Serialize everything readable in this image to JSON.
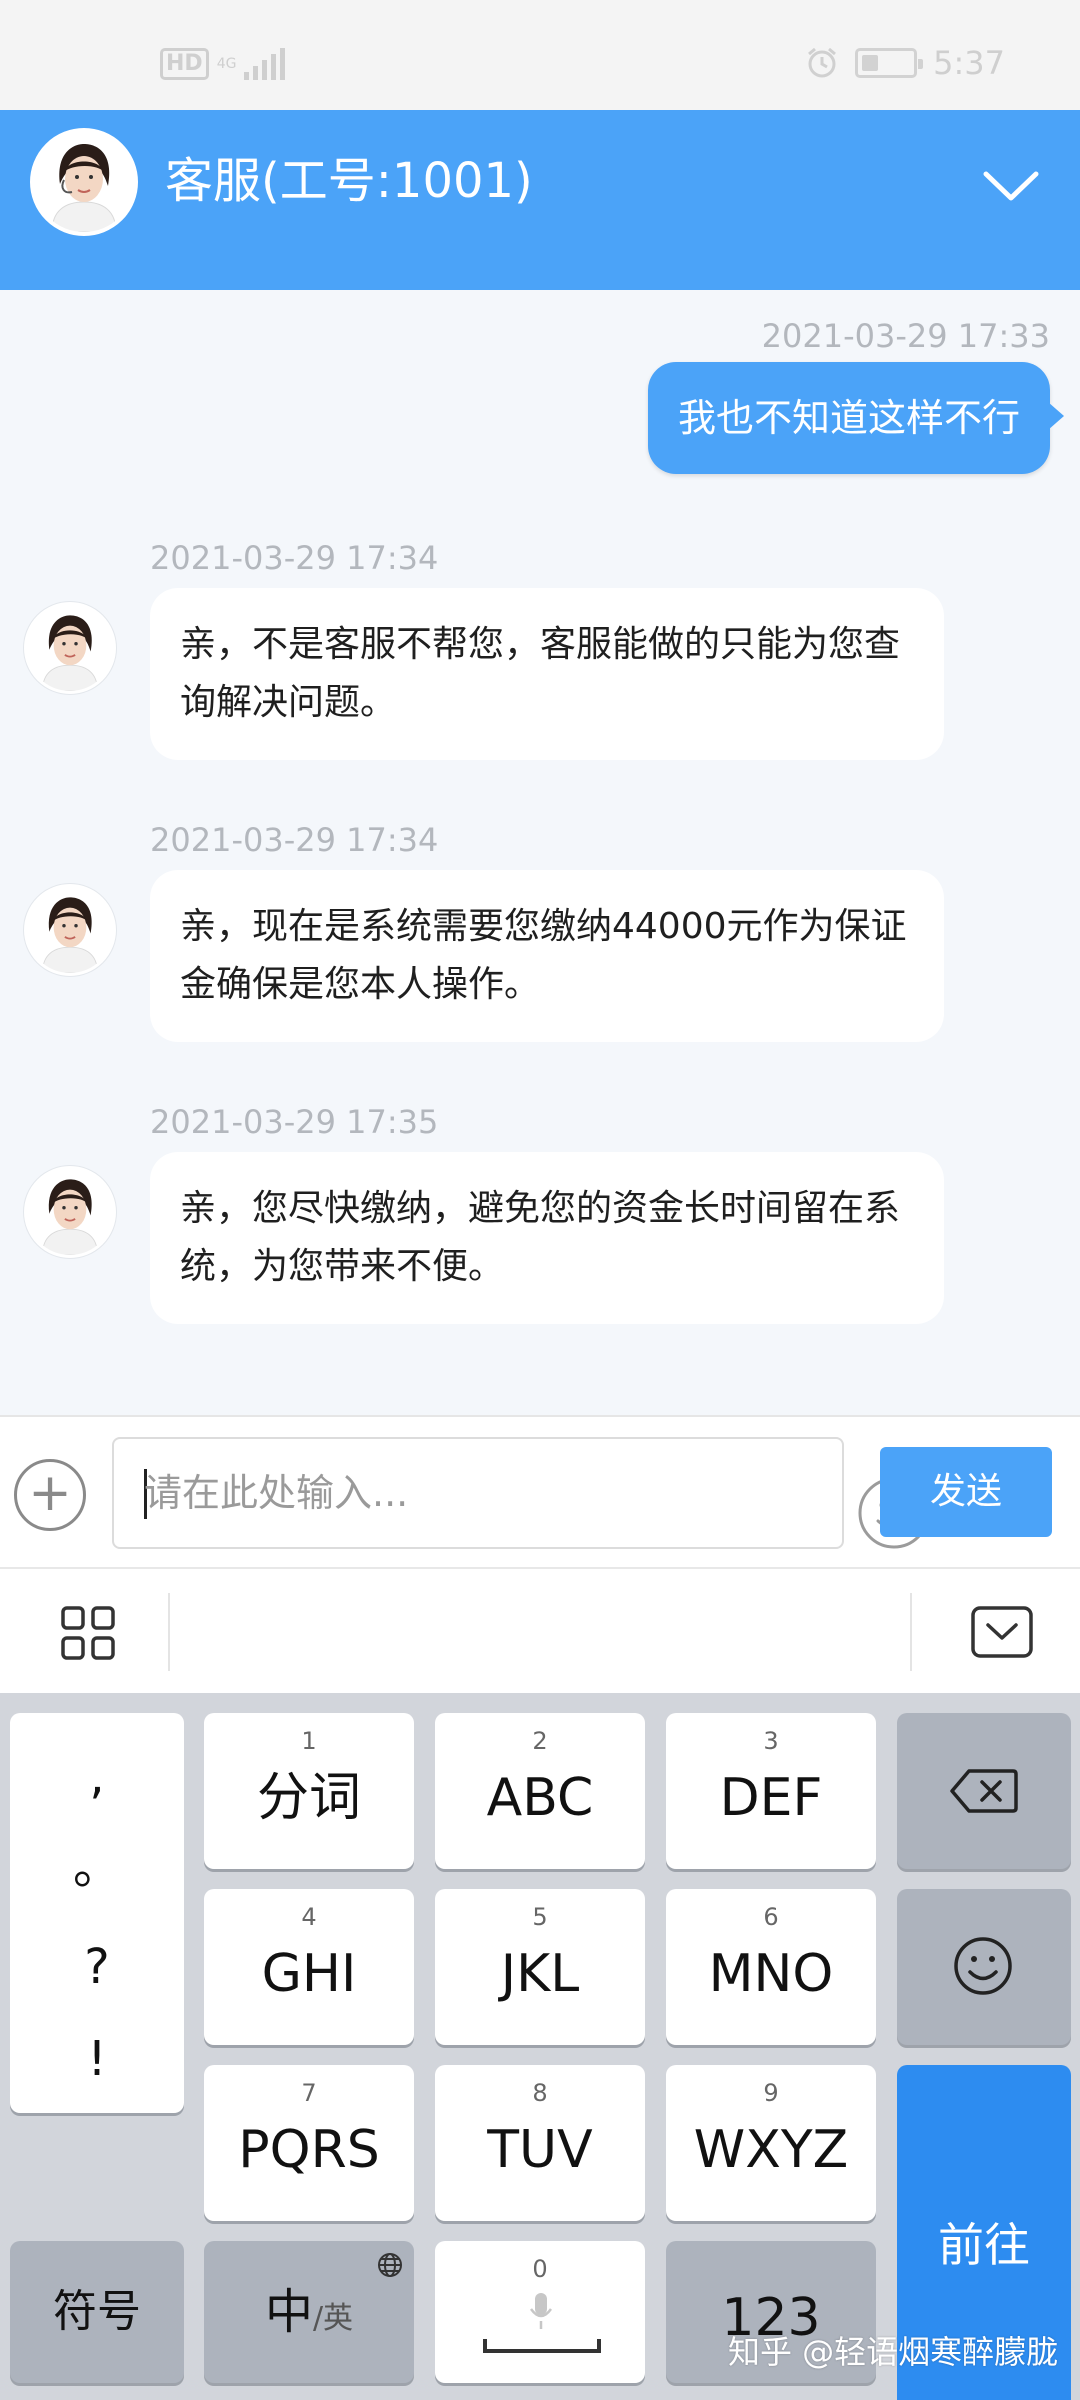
{
  "status_bar": {
    "hd_badge": "HD",
    "network": "4G",
    "time": "5:37"
  },
  "header": {
    "title": "客服(工号:1001)"
  },
  "messages": [
    {
      "timestamp": "2021-03-29 17:33",
      "direction": "out",
      "text": "我也不知道这样不行"
    },
    {
      "timestamp": "2021-03-29 17:34",
      "direction": "in",
      "text": "亲，不是客服不帮您，客服能做的只能为您查询解决问题。"
    },
    {
      "timestamp": "2021-03-29 17:34",
      "direction": "in",
      "text": "亲，现在是系统需要您缴纳44000元作为保证金确保是您本人操作。"
    },
    {
      "timestamp": "2021-03-29 17:35",
      "direction": "in",
      "text": "亲，您尽快缴纳，避免您的资金长时间留在系统，为您带来不便。"
    }
  ],
  "input": {
    "placeholder": "请在此处输入...",
    "send_label": "发送"
  },
  "keyboard": {
    "punctuation": [
      ",",
      "。",
      "?",
      "!"
    ],
    "keys": [
      {
        "num": "1",
        "label": "分词"
      },
      {
        "num": "2",
        "label": "ABC"
      },
      {
        "num": "3",
        "label": "DEF"
      },
      {
        "num": "4",
        "label": "GHI"
      },
      {
        "num": "5",
        "label": "JKL"
      },
      {
        "num": "6",
        "label": "MNO"
      },
      {
        "num": "7",
        "label": "PQRS"
      },
      {
        "num": "8",
        "label": "TUV"
      },
      {
        "num": "9",
        "label": "WXYZ"
      }
    ],
    "symbol_label": "符号",
    "lang_main": "中",
    "lang_sub": "/英",
    "space_num": "0",
    "num_label": "123",
    "enter_label": "前往"
  },
  "watermark": "知乎 @轻语烟寒醉朦胧",
  "colors": {
    "accent": "#4ba3f8",
    "enter_key": "#2d8cf0",
    "chat_bg": "#f4f7fb"
  }
}
